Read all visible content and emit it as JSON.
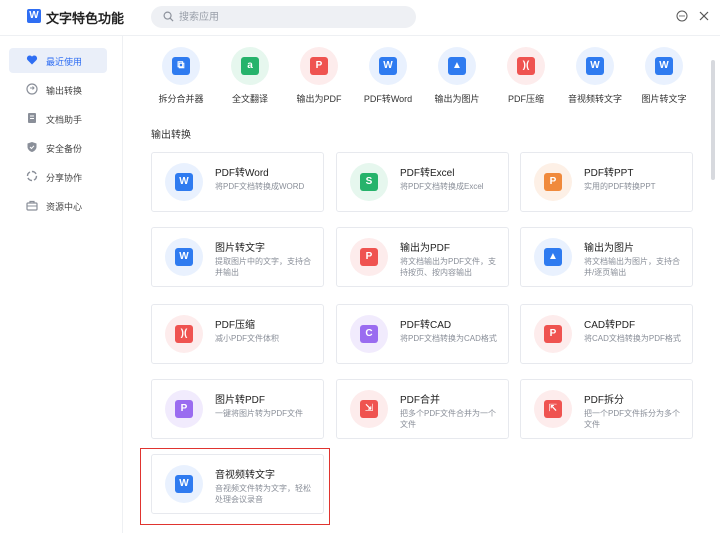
{
  "header": {
    "app_title": "文字特色功能",
    "search_placeholder": "搜索应用"
  },
  "sidebar": {
    "items": [
      {
        "label": "最近使用",
        "icon": "heart-icon",
        "active": true
      },
      {
        "label": "输出转换",
        "icon": "convert-icon"
      },
      {
        "label": "文档助手",
        "icon": "document-icon"
      },
      {
        "label": "安全备份",
        "icon": "shield-icon"
      },
      {
        "label": "分享协作",
        "icon": "share-icon"
      },
      {
        "label": "资源中心",
        "icon": "resource-icon"
      }
    ]
  },
  "quick_access": [
    {
      "label": "拆分合并器",
      "icon": "split-merge-icon",
      "color": "#2f7bf0",
      "bg": "#e9f1fe"
    },
    {
      "label": "全文翻译",
      "icon": "translate-icon",
      "color": "#26b36b",
      "bg": "#e6f7ee"
    },
    {
      "label": "输出为PDF",
      "icon": "export-pdf-icon",
      "color": "#ef5350",
      "bg": "#fdecec"
    },
    {
      "label": "PDF转Word",
      "icon": "pdf-to-word-icon",
      "color": "#2f7bf0",
      "bg": "#e9f1fe"
    },
    {
      "label": "输出为图片",
      "icon": "export-image-icon",
      "color": "#2f7bf0",
      "bg": "#e9f1fe"
    },
    {
      "label": "PDF压缩",
      "icon": "pdf-compress-icon",
      "color": "#ef5350",
      "bg": "#fdecec"
    },
    {
      "label": "音视频转文字",
      "icon": "av-to-text-icon",
      "color": "#2f7bf0",
      "bg": "#e9f1fe"
    },
    {
      "label": "图片转文字",
      "icon": "image-to-text-icon",
      "color": "#2f7bf0",
      "bg": "#e9f1fe"
    }
  ],
  "section": {
    "title": "输出转换"
  },
  "cards": [
    {
      "title": "PDF转Word",
      "desc": "将PDF文档转换成WORD",
      "icon": "pdf-to-word-icon",
      "glyph": "W",
      "color": "#2f7bf0",
      "bg": "#e9f1fe"
    },
    {
      "title": "PDF转Excel",
      "desc": "将PDF文档转换成Excel",
      "icon": "pdf-to-excel-icon",
      "glyph": "S",
      "color": "#26b36b",
      "bg": "#e6f7ee"
    },
    {
      "title": "PDF转PPT",
      "desc": "实用的PDF转换PPT",
      "icon": "pdf-to-ppt-icon",
      "glyph": "P",
      "color": "#f08a3c",
      "bg": "#fdf0e6"
    },
    {
      "title": "图片转文字",
      "desc": "提取图片中的文字，支持合并输出",
      "icon": "image-to-text-icon",
      "glyph": "W",
      "color": "#2f7bf0",
      "bg": "#e9f1fe"
    },
    {
      "title": "输出为PDF",
      "desc": "将文档输出为PDF文件，支持按页、按内容输出",
      "icon": "export-pdf-icon",
      "glyph": "P",
      "color": "#ef5350",
      "bg": "#fdecec"
    },
    {
      "title": "输出为图片",
      "desc": "将文档输出为图片，支持合并/逐页输出",
      "icon": "export-image-icon",
      "glyph": "▲",
      "color": "#2f7bf0",
      "bg": "#e9f1fe"
    },
    {
      "title": "PDF压缩",
      "desc": "减小PDF文件体积",
      "icon": "pdf-compress-icon",
      "glyph": ")(",
      "color": "#ef5350",
      "bg": "#fdecec"
    },
    {
      "title": "PDF转CAD",
      "desc": "将PDF文档转换为CAD格式",
      "icon": "pdf-to-cad-icon",
      "glyph": "C",
      "color": "#9a6cf0",
      "bg": "#f1ebfd"
    },
    {
      "title": "CAD转PDF",
      "desc": "将CAD文档转换为PDF格式",
      "icon": "cad-to-pdf-icon",
      "glyph": "P",
      "color": "#ef5350",
      "bg": "#fdecec"
    },
    {
      "title": "图片转PDF",
      "desc": "一键将图片转为PDF文件",
      "icon": "image-to-pdf-icon",
      "glyph": "P",
      "color": "#9a6cf0",
      "bg": "#f1ebfd"
    },
    {
      "title": "PDF合并",
      "desc": "把多个PDF文件合并为一个文件",
      "icon": "pdf-merge-icon",
      "glyph": "⇲",
      "color": "#ef5350",
      "bg": "#fdecec"
    },
    {
      "title": "PDF拆分",
      "desc": "把一个PDF文件拆分为多个文件",
      "icon": "pdf-split-icon",
      "glyph": "⇱",
      "color": "#ef5350",
      "bg": "#fdecec"
    },
    {
      "title": "音视频转文字",
      "desc": "音视频文件转为文字，轻松处理会议录音",
      "icon": "av-to-text-icon",
      "glyph": "W",
      "color": "#2f7bf0",
      "bg": "#e9f1fe"
    }
  ]
}
